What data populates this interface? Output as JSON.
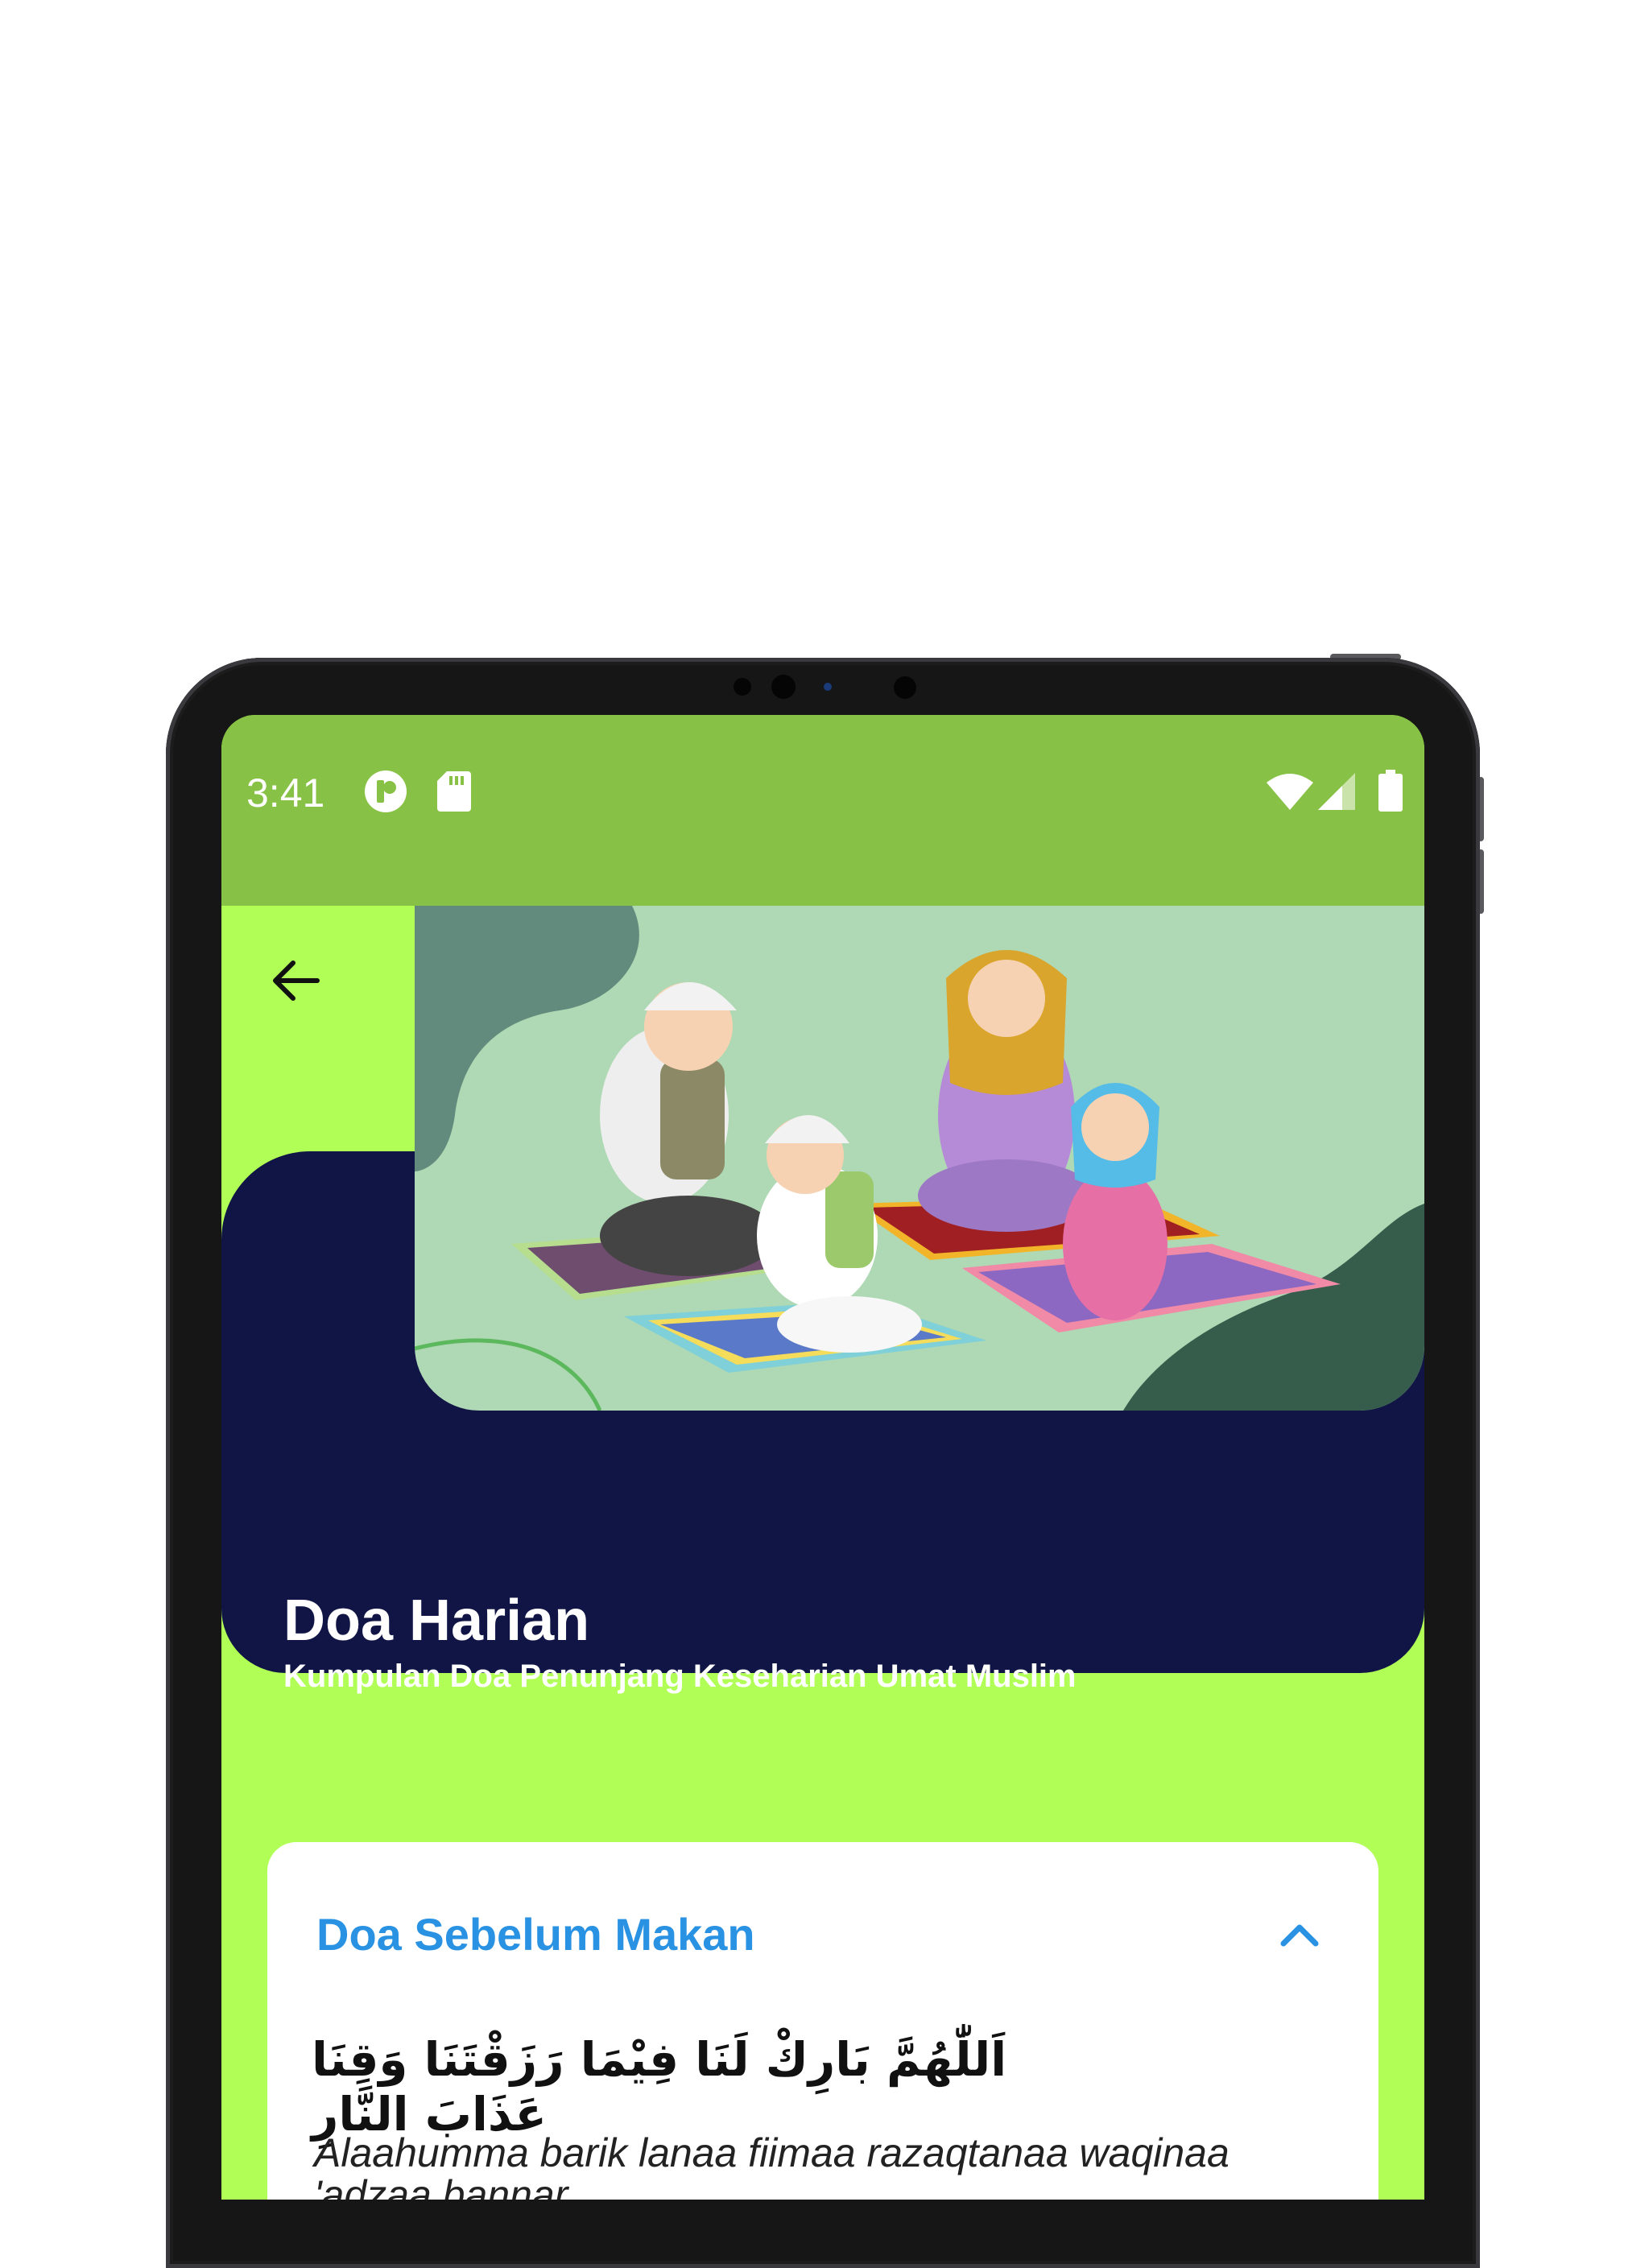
{
  "status_bar": {
    "time": "3:41",
    "icons": [
      "app-notification-icon",
      "sd-card-icon",
      "wifi-icon",
      "signal-icon",
      "battery-icon"
    ]
  },
  "header": {
    "title": "Doa Harian",
    "subtitle": "Kumpulan Doa Penunjang Keseharian Umat Muslim"
  },
  "prayer": {
    "title": "Doa Sebelum Makan",
    "arabic": "اَللّٰهُمَّ بَارِكْ لَنَا فِيْمَا رَزَقْتَنَا وَقِنَا عَذَابَ النَّارِ",
    "latin": "Alaahumma barik lanaa fiimaa razaqtanaa waqinaa 'adzaa bannar"
  },
  "colors": {
    "status_bar": "#87c145",
    "background": "#b1fe57",
    "hero": "#101545",
    "accent": "#2a92e3"
  }
}
